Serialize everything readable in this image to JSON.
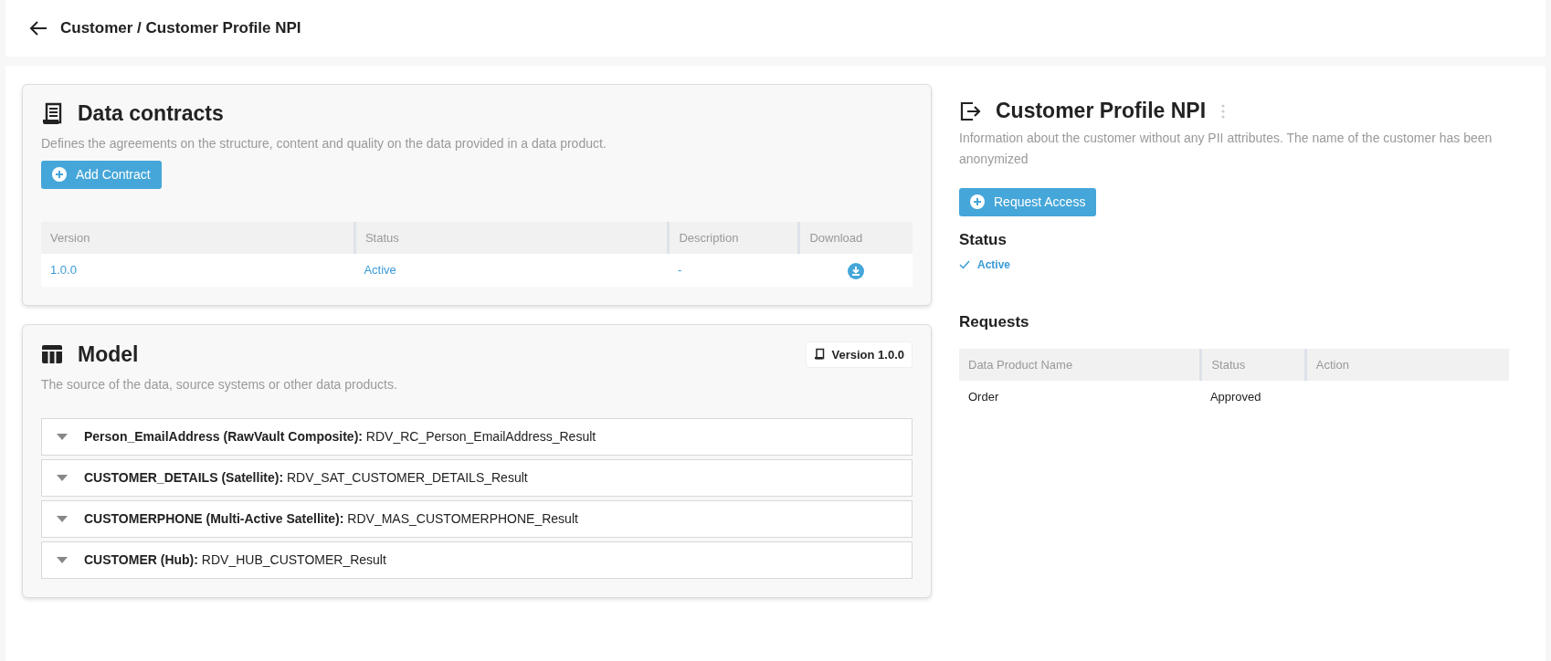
{
  "breadcrumb": "Customer / Customer Profile NPI",
  "contracts": {
    "title": "Data contracts",
    "description": "Defines the agreements on the structure, content and quality on the data provided in a data product.",
    "add_button": "Add Contract",
    "columns": [
      "Version",
      "Status",
      "Description",
      "Download"
    ],
    "rows": [
      {
        "version": "1.0.0",
        "status": "Active",
        "description": "-"
      }
    ]
  },
  "model": {
    "title": "Model",
    "version_badge": "Version 1.0.0",
    "description": "The source of the data, source systems or other data products.",
    "items": [
      {
        "text": "**Person_EmailAddress (RawVault Composite):** RDV_RC_Person_EmailAddress_Result",
        "expanded": false
      },
      {
        "text": "**CUSTOMER_DETAILS (Satellite):** RDV_SAT_CUSTOMER_DETAILS_Result",
        "expanded": false
      },
      {
        "text": "**CUSTOMERPHONE (Multi-Active Satellite):** RDV_MAS_CUSTOMERPHONE_Result",
        "expanded": false
      },
      {
        "text": "**CUSTOMER (Hub):** RDV_HUB_CUSTOMER_Result",
        "expanded": false
      }
    ]
  },
  "product": {
    "title": "Customer Profile NPI",
    "description": "Information about the customer without any PII attributes. The name of the customer has been anonymized",
    "request_button": "Request Access",
    "status_heading": "Status",
    "status": "Active",
    "requests_heading": "Requests",
    "request_columns": [
      "Data Product Name",
      "Status",
      "Action"
    ],
    "requests": [
      {
        "name": "Order",
        "status": "Approved"
      }
    ]
  }
}
